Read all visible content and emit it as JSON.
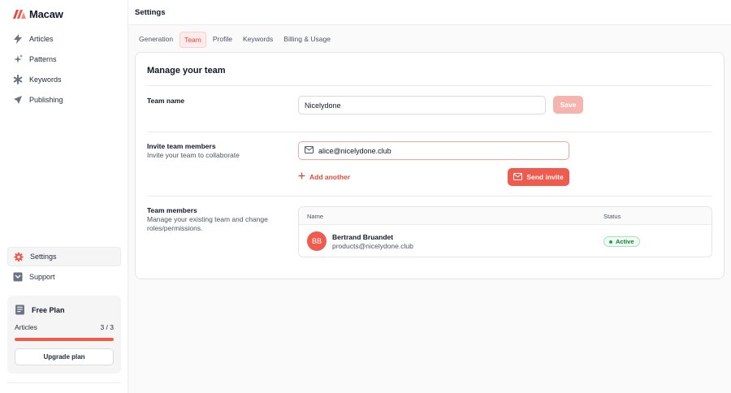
{
  "app": {
    "name": "Macaw"
  },
  "sidebar": {
    "items": [
      {
        "label": "Articles",
        "icon": "lightning-icon"
      },
      {
        "label": "Patterns",
        "icon": "sparkles-icon"
      },
      {
        "label": "Keywords",
        "icon": "asterisk-icon"
      },
      {
        "label": "Publishing",
        "icon": "paper-plane-icon"
      }
    ],
    "bottom_items": [
      {
        "label": "Settings",
        "icon": "gear-icon",
        "active": true
      },
      {
        "label": "Support",
        "icon": "support-icon"
      }
    ],
    "plan": {
      "title": "Free Plan",
      "metric_label": "Articles",
      "metric_value": "3 / 3",
      "progress": 1.0,
      "upgrade_label": "Upgrade plan"
    }
  },
  "header": {
    "title": "Settings"
  },
  "tabs": [
    {
      "label": "Generation",
      "active": false
    },
    {
      "label": "Team",
      "active": true
    },
    {
      "label": "Profile",
      "active": false
    },
    {
      "label": "Keywords",
      "active": false
    },
    {
      "label": "Billing & Usage",
      "active": false
    }
  ],
  "card": {
    "title": "Manage your team",
    "team_name": {
      "label": "Team name",
      "value": "Nicelydone",
      "save_label": "Save"
    },
    "invite": {
      "label": "Invite team members",
      "description": "Invite your team to collaborate",
      "email_value": "alice@nicelydone.club",
      "add_another_label": "Add another",
      "send_label": "Send invite"
    },
    "members": {
      "label": "Team members",
      "description": "Manage your existing team and change roles/permissions.",
      "columns": {
        "name": "Name",
        "status": "Status"
      },
      "rows": [
        {
          "initials": "BB",
          "name": "Bertrand Bruandet",
          "email": "products@nicelydone.club",
          "status": "Active"
        }
      ]
    }
  },
  "colors": {
    "accent": "#ef5b4c",
    "accent_light": "#f5b4ad",
    "success": "#16803c"
  }
}
